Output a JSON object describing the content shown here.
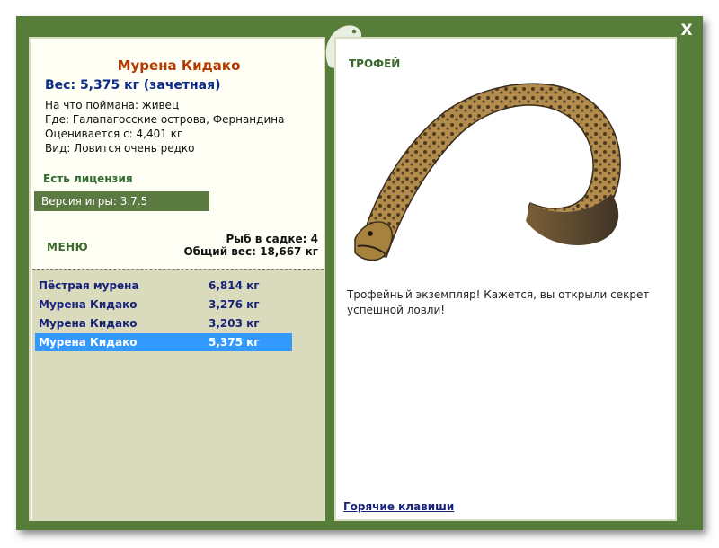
{
  "header": {
    "close_label": "X"
  },
  "fish": {
    "title": "Мурена Кидако",
    "weight": "Вес: 5,375 кг (зачетная)",
    "bait": "На что поймана: живец",
    "location": "Где: Галапагосские острова, Фернандина",
    "value": "Оценивается с: 4,401 кг",
    "rarity": "Вид: Ловится очень редко"
  },
  "license": "Есть лицензия",
  "version": "Версия игры: 3.7.5",
  "menu": {
    "label": "МЕНЮ"
  },
  "cage": {
    "count": "Рыб в садке: 4",
    "total": "Общий вес: 18,667 кг"
  },
  "catches": [
    {
      "name": "Пёстрая мурена",
      "weight": "6,814 кг"
    },
    {
      "name": "Мурена Кидако",
      "weight": "3,276 кг"
    },
    {
      "name": "Мурена Кидако",
      "weight": "3,203 кг"
    },
    {
      "name": "Мурена Кидако",
      "weight": "5,375 кг"
    }
  ],
  "trophy": {
    "label": "ТРОФЕЙ",
    "text": "Трофейный экземпляр! Кажется, вы открыли секрет успешной ловли!"
  },
  "footer": {
    "hotkeys_label": "Горячие клавиши"
  },
  "colors": {
    "frame": "#567e3a",
    "title": "#b23a00",
    "link": "#17227a",
    "selection": "#3399ff"
  }
}
